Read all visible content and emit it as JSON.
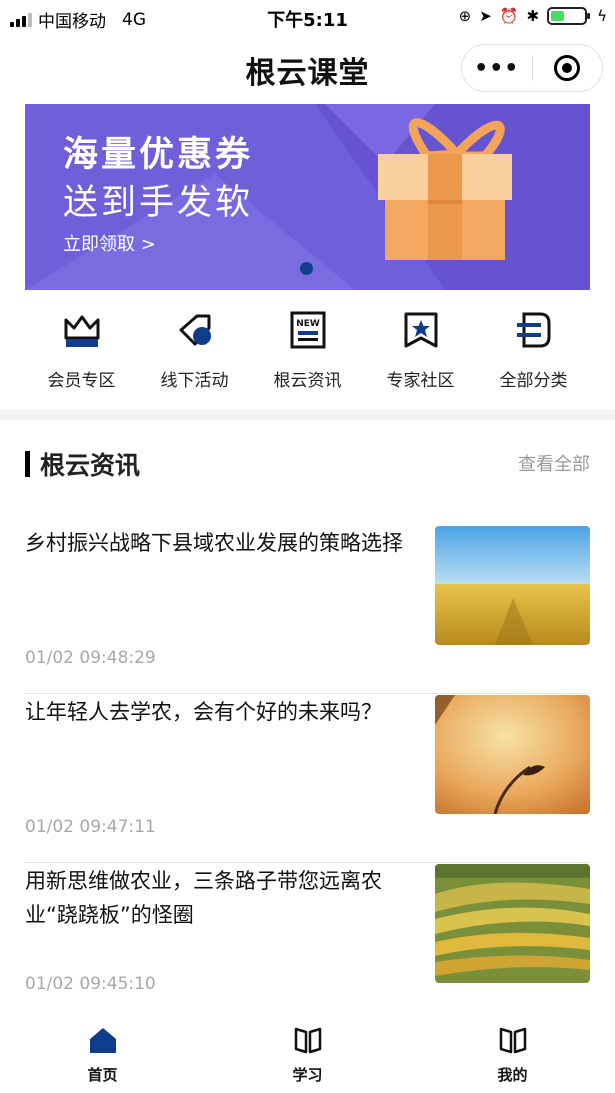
{
  "status_bar": {
    "carrier": "中国移动",
    "network": "4G",
    "time": "下午5:11",
    "battery_level": 0.4,
    "colors": {
      "battery": "#4cd964"
    }
  },
  "nav": {
    "title": "根云课堂",
    "more_icon": "more-dots-icon",
    "close_icon": "target-icon"
  },
  "banner": {
    "title": "海量优惠券",
    "subtitle": "送到手发软",
    "cta": "立即领取 >",
    "image_icon": "gift-box-icon",
    "colors": {
      "background": "#6f5fd9",
      "dot": "#0f3d8c"
    }
  },
  "categories": [
    {
      "label": "会员专区",
      "icon": "crown-icon"
    },
    {
      "label": "线下活动",
      "icon": "tag-icon"
    },
    {
      "label": "根云资讯",
      "icon": "newspaper-icon"
    },
    {
      "label": "专家社区",
      "icon": "bookmark-star-icon"
    },
    {
      "label": "全部分类",
      "icon": "category-icon"
    }
  ],
  "section": {
    "title": "根云资讯",
    "more": "查看全部"
  },
  "news": [
    {
      "title": "乡村振兴战略下县域农业发展的策略选择",
      "time": "01/02 09:48:29",
      "thumb": "wheat-field-image"
    },
    {
      "title": "让年轻人去学农，会有个好的未来吗？",
      "time": "01/02 09:47:11",
      "thumb": "grain-ear-image"
    },
    {
      "title": "用新思维做农业，三条路子带您远离农业“跷跷板”的怪圈",
      "time": "01/02 09:45:10",
      "thumb": "terraced-field-image"
    }
  ],
  "tabs": [
    {
      "label": "首页",
      "icon": "home-icon",
      "active": true
    },
    {
      "label": "学习",
      "icon": "book-icon",
      "active": false
    },
    {
      "label": "我的",
      "icon": "profile-book-icon",
      "active": false
    }
  ],
  "colors": {
    "brand_blue": "#0f3d8c",
    "muted_text": "#a8a8a8"
  }
}
